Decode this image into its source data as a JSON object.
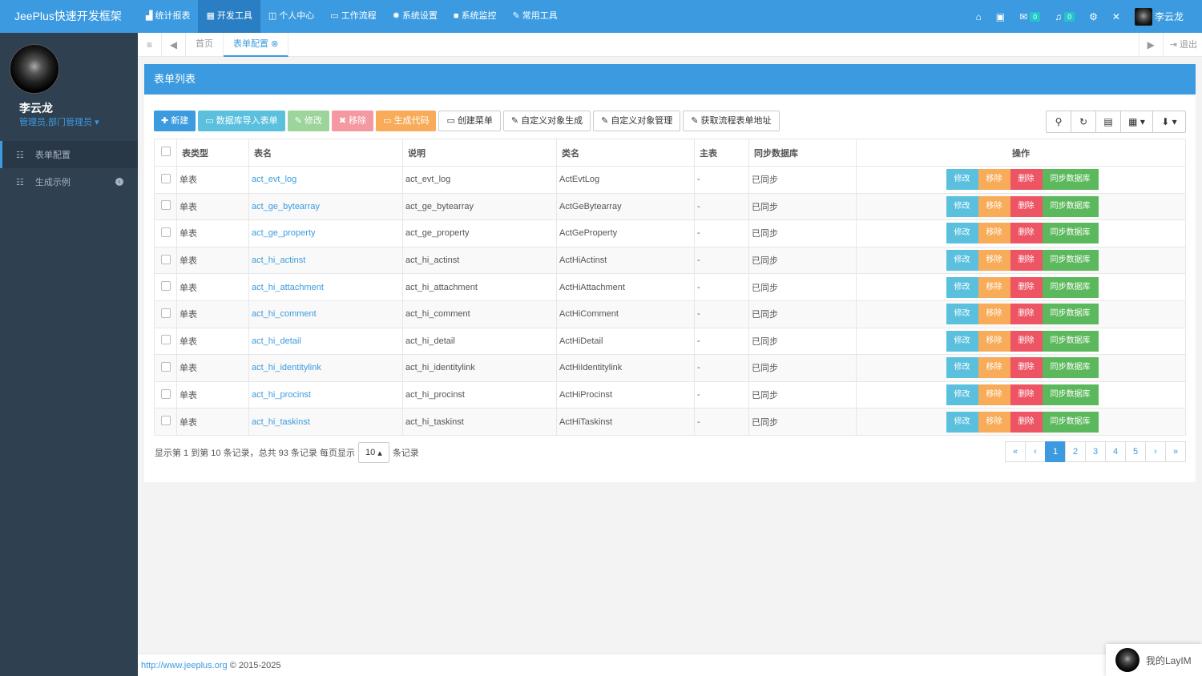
{
  "brand": "JeePlus快速开发框架",
  "topmenu": [
    {
      "icon": "bar-chart-icon",
      "glyph": "▟",
      "label": "统计报表"
    },
    {
      "icon": "grid-icon",
      "glyph": "▦",
      "label": "开发工具"
    },
    {
      "icon": "id-card-icon",
      "glyph": "◫",
      "label": "个人中心"
    },
    {
      "icon": "desktop-icon",
      "glyph": "▭",
      "label": "工作流程"
    },
    {
      "icon": "gear-icon",
      "glyph": "✹",
      "label": "系统设置"
    },
    {
      "icon": "video-camera-icon",
      "glyph": "■",
      "label": "系统监控"
    },
    {
      "icon": "wrench-icon",
      "glyph": "✎",
      "label": "常用工具"
    }
  ],
  "topright": {
    "mail_count": "0",
    "bell_count": "0",
    "username": "李云龙"
  },
  "sidebar": {
    "name": "李云龙",
    "role": "管理员,部门管理员",
    "items": [
      {
        "label": "表单配置"
      },
      {
        "label": "生成示例"
      }
    ]
  },
  "tabs": {
    "home": "首页",
    "current": "表单配置",
    "logout": "退出"
  },
  "panel_title": "表单列表",
  "toolbar": {
    "new": "新建",
    "import": "数据库导入表单",
    "edit": "修改",
    "remove": "移除",
    "gen_code": "生成代码",
    "create_menu": "创建菜单",
    "custom_gen": "自定义对象生成",
    "custom_manage": "自定义对象管理",
    "flow_url": "获取流程表单地址"
  },
  "table": {
    "headers": [
      "表类型",
      "表名",
      "说明",
      "类名",
      "主表",
      "同步数据库",
      "操作"
    ],
    "op_labels": {
      "edit": "修改",
      "remove": "移除",
      "delete": "删除",
      "sync": "同步数据库"
    },
    "rows": [
      {
        "type": "单表",
        "name": "act_evt_log",
        "desc": "act_evt_log",
        "cls": "ActEvtLog",
        "master": "-",
        "sync": "已同步"
      },
      {
        "type": "单表",
        "name": "act_ge_bytearray",
        "desc": "act_ge_bytearray",
        "cls": "ActGeBytearray",
        "master": "-",
        "sync": "已同步"
      },
      {
        "type": "单表",
        "name": "act_ge_property",
        "desc": "act_ge_property",
        "cls": "ActGeProperty",
        "master": "-",
        "sync": "已同步"
      },
      {
        "type": "单表",
        "name": "act_hi_actinst",
        "desc": "act_hi_actinst",
        "cls": "ActHiActinst",
        "master": "-",
        "sync": "已同步"
      },
      {
        "type": "单表",
        "name": "act_hi_attachment",
        "desc": "act_hi_attachment",
        "cls": "ActHiAttachment",
        "master": "-",
        "sync": "已同步"
      },
      {
        "type": "单表",
        "name": "act_hi_comment",
        "desc": "act_hi_comment",
        "cls": "ActHiComment",
        "master": "-",
        "sync": "已同步"
      },
      {
        "type": "单表",
        "name": "act_hi_detail",
        "desc": "act_hi_detail",
        "cls": "ActHiDetail",
        "master": "-",
        "sync": "已同步"
      },
      {
        "type": "单表",
        "name": "act_hi_identitylink",
        "desc": "act_hi_identitylink",
        "cls": "ActHiIdentitylink",
        "master": "-",
        "sync": "已同步"
      },
      {
        "type": "单表",
        "name": "act_hi_procinst",
        "desc": "act_hi_procinst",
        "cls": "ActHiProcinst",
        "master": "-",
        "sync": "已同步"
      },
      {
        "type": "单表",
        "name": "act_hi_taskinst",
        "desc": "act_hi_taskinst",
        "cls": "ActHiTaskinst",
        "master": "-",
        "sync": "已同步"
      }
    ]
  },
  "pagination": {
    "info": "显示第 1 到第 10 条记录，总共 93 条记录 每页显示",
    "page_size": "10",
    "suffix": "条记录",
    "pages": [
      "«",
      "‹",
      "1",
      "2",
      "3",
      "4",
      "5",
      "›",
      "»"
    ],
    "current": "1"
  },
  "footer": {
    "url": "http://www.jeeplus.org",
    "copyright": "© 2015-2025"
  },
  "layim": "我的LayIM",
  "colors": {
    "primary": "#3c9be0",
    "sidebar": "#2f4050",
    "teal": "#5bc0de",
    "orange": "#f8ac59",
    "red": "#ed5565",
    "green": "#5cb85c"
  }
}
